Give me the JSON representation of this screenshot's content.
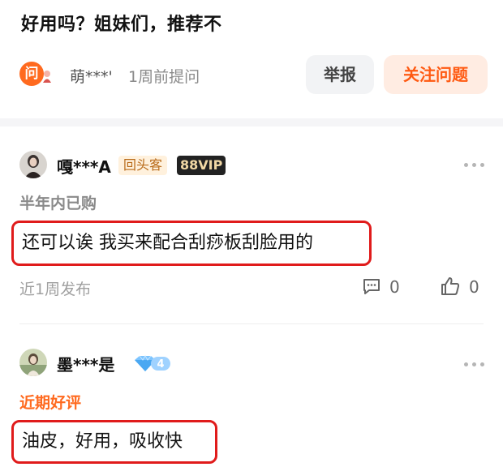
{
  "question": {
    "title": "好用吗？姐妹们，推荐不",
    "avatar_char": "问",
    "asker_name": "萌***'",
    "time": "1周前提问",
    "report_label": "举报",
    "follow_label": "关注问题"
  },
  "answers": [
    {
      "user": "嘎***A",
      "tags": [
        "回头客",
        "88VIP"
      ],
      "purchase_info": "半年内已购",
      "content": "还可以诶 我买来配合刮痧板刮脸用的",
      "time": "近1周发布",
      "comments": "0",
      "likes": "0"
    },
    {
      "user": "墨***是",
      "level": "4",
      "purchase_info": "近期好评",
      "content": "油皮，好用，吸收快"
    }
  ],
  "colors": {
    "accent": "#ff6a1f",
    "highlight_border": "#e01b1b",
    "vip_bg": "#222222"
  },
  "icons": [
    "more-icon",
    "comment-icon",
    "thumbs-up-icon",
    "diamond-level-icon"
  ]
}
